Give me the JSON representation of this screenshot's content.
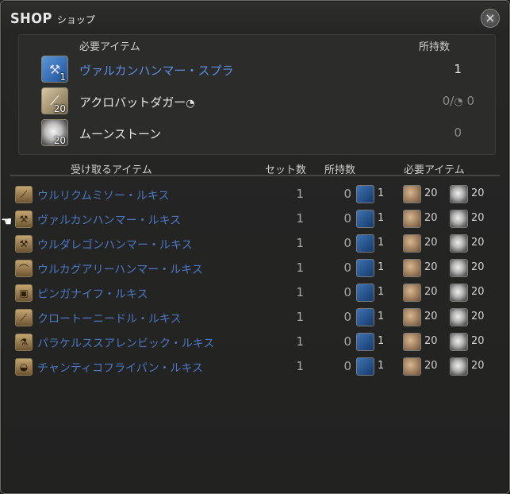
{
  "window": {
    "title_big": "SHOP",
    "title_small": "ショップ",
    "close_icon": "×"
  },
  "required_panel": {
    "header_item": "必要アイテム",
    "header_owned": "所持数",
    "items": [
      {
        "name": "ヴァルカンハンマー・スプラ",
        "qty_badge": "1",
        "owned": "1",
        "icon": "hammer-icon"
      },
      {
        "name": "アクロバットダガー",
        "qty_badge": "20",
        "owned": "0/",
        "owned_suffix": "0",
        "icon": "dagger-icon",
        "hq": "◔"
      },
      {
        "name": "ムーンストーン",
        "qty_badge": "20",
        "owned": "0",
        "icon": "moonstone-icon"
      }
    ]
  },
  "columns": {
    "receive": "受け取るアイテム",
    "set_count": "セット数",
    "owned": "所持数",
    "required": "必要アイテム"
  },
  "rows": [
    {
      "name": "ウルリクムミソー・ルキス",
      "set": "1",
      "owned": "0",
      "r1": "1",
      "r2": "20",
      "r3": "20",
      "icon": "saw-icon"
    },
    {
      "name": "ヴァルカンハンマー・ルキス",
      "set": "1",
      "owned": "0",
      "r1": "1",
      "r2": "20",
      "r3": "20",
      "icon": "hammer-icon"
    },
    {
      "name": "ウルダレゴンハンマー・ルキス",
      "set": "1",
      "owned": "0",
      "r1": "1",
      "r2": "20",
      "r3": "20",
      "icon": "hammer-icon"
    },
    {
      "name": "ウルカグアリーハンマー・ルキス",
      "set": "1",
      "owned": "0",
      "r1": "1",
      "r2": "20",
      "r3": "20",
      "icon": "hammer-icon"
    },
    {
      "name": "ピンガナイフ・ルキス",
      "set": "1",
      "owned": "0",
      "r1": "1",
      "r2": "20",
      "r3": "20",
      "icon": "knife-icon"
    },
    {
      "name": "クロートーニードル・ルキス",
      "set": "1",
      "owned": "0",
      "r1": "1",
      "r2": "20",
      "r3": "20",
      "icon": "needle-icon"
    },
    {
      "name": "パラケルススアレンビック・ルキス",
      "set": "1",
      "owned": "0",
      "r1": "1",
      "r2": "20",
      "r3": "20",
      "icon": "alembic-icon"
    },
    {
      "name": "チャンティコフライパン・ルキス",
      "set": "1",
      "owned": "0",
      "r1": "1",
      "r2": "20",
      "r3": "20",
      "icon": "frypan-icon"
    }
  ],
  "colors": {
    "hq_item_blue": "#5a8fe6",
    "list_item_blue": "#4a78c6"
  }
}
